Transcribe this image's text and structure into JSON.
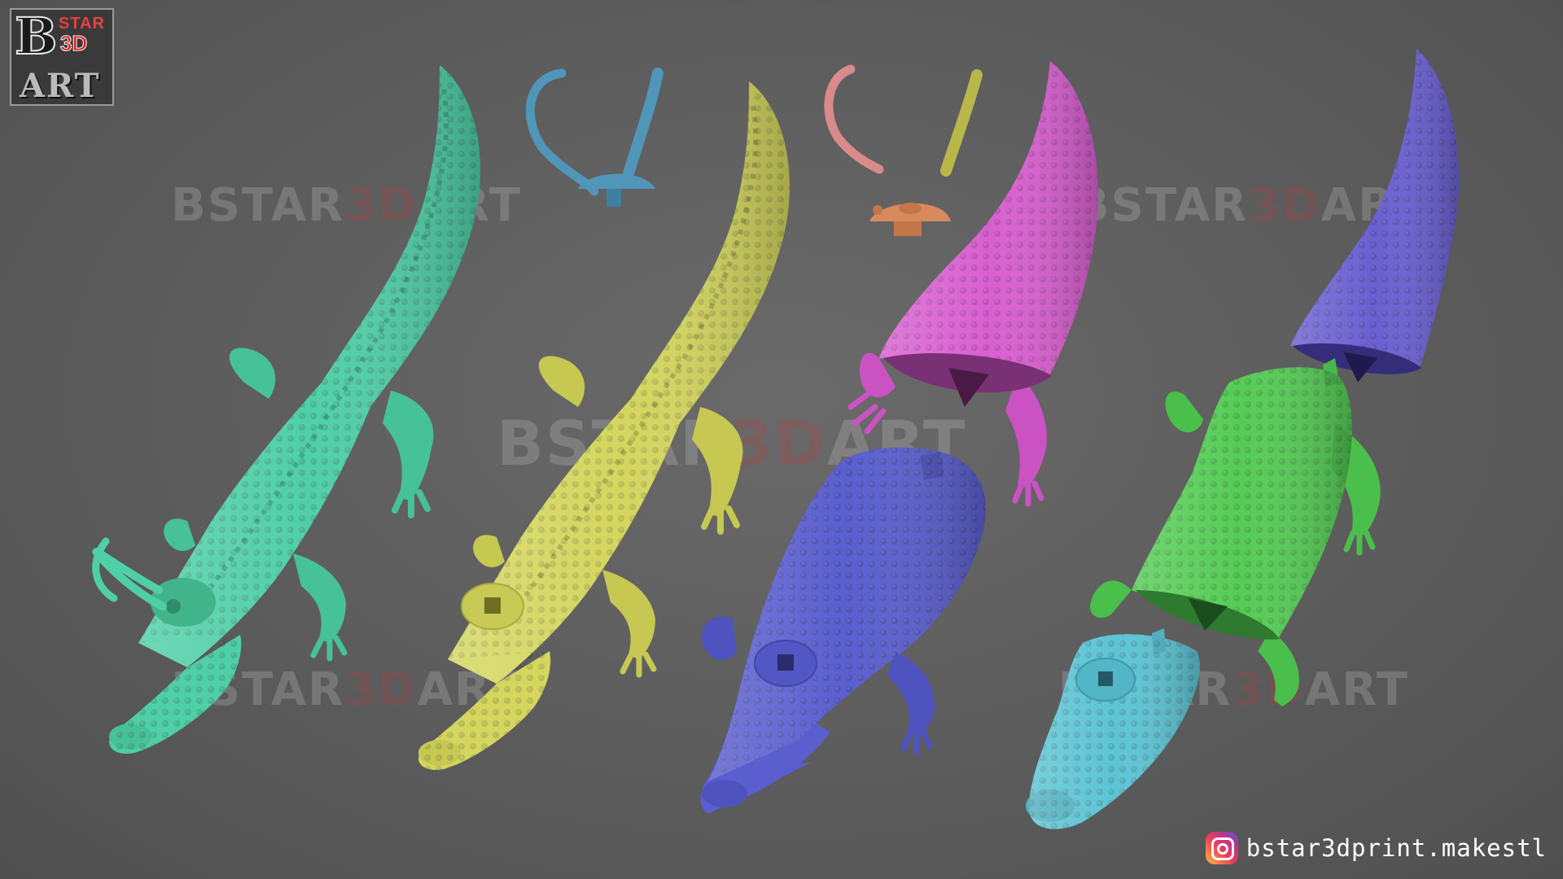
{
  "logo": {
    "letter": "B",
    "star": "STAR",
    "three_d": "3D",
    "art": "ART"
  },
  "watermark": {
    "part1": "BSTAR",
    "part2": "3D",
    "part3": "ART"
  },
  "social": {
    "icon": "instagram-icon",
    "handle": "bstar3dprint.makestl"
  },
  "models": [
    {
      "name": "assembled-alligator",
      "color": "#4fcfa6"
    },
    {
      "name": "alligator-body-with-socket",
      "color": "#d4d65e"
    },
    {
      "name": "split-alligator-front",
      "color": "#5a5ecf"
    },
    {
      "name": "split-alligator-tail",
      "color": "#d95fd1"
    },
    {
      "name": "exploded-alligator-tail",
      "color": "#6b5fd1"
    },
    {
      "name": "exploded-alligator-torso",
      "color": "#55cc55"
    },
    {
      "name": "exploded-alligator-head",
      "color": "#5cc4d4"
    }
  ],
  "parts": [
    {
      "name": "horn-set-blue",
      "color": "#4f96b8"
    },
    {
      "name": "horn-left-pink",
      "color": "#d98a8a"
    },
    {
      "name": "horn-right-olive",
      "color": "#b8b84a"
    },
    {
      "name": "helmet-cap-orange",
      "color": "#d98a5c"
    }
  ]
}
